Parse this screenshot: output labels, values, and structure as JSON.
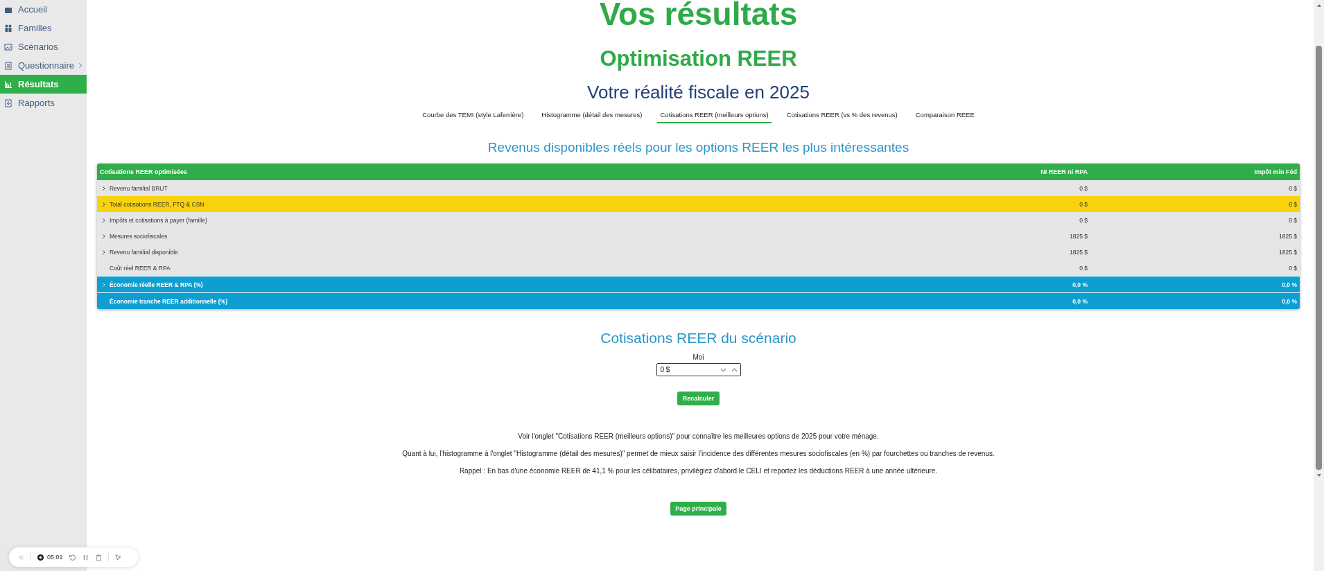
{
  "sidebar": {
    "items": [
      {
        "label": "Accueil",
        "selected": false,
        "submenu": false
      },
      {
        "label": "Familles",
        "selected": false,
        "submenu": false
      },
      {
        "label": "Scénarios",
        "selected": false,
        "submenu": false
      },
      {
        "label": "Questionnaire",
        "selected": false,
        "submenu": true
      },
      {
        "label": "Résultats",
        "selected": true,
        "submenu": false
      },
      {
        "label": "Rapports",
        "selected": false,
        "submenu": false
      }
    ]
  },
  "page_title": "Vos résultats",
  "section_title": "Optimisation REER",
  "subtitle": "Votre réalité fiscale en 2025",
  "tabs": [
    {
      "label": "Courbe des TEMI (style Laferrière)",
      "selected": false
    },
    {
      "label": "Histogramme (détail des mesures)",
      "selected": false
    },
    {
      "label": "Cotisations REER (meilleurs options)",
      "selected": true
    },
    {
      "label": "Cotisations REER (vs % des revenus)",
      "selected": false
    },
    {
      "label": "Comparaison REEE",
      "selected": false
    }
  ],
  "table_title": "Revenus disponibles réels pour les options REER les plus intéressantes",
  "table": {
    "columns": [
      "Cotisations REER optimisées",
      "NI REER ni RPA",
      "Impôt min Féd"
    ],
    "rows": [
      {
        "label": "Revenu familial BRUT",
        "kind": "normal",
        "expandable": true,
        "values": [
          "0 $",
          "0 $"
        ]
      },
      {
        "label": "Total cotisations REER, FTQ & CSN",
        "kind": "highlight",
        "expandable": true,
        "values": [
          "0 $",
          "0 $"
        ]
      },
      {
        "label": "Impôts et cotisations à payer (famille)",
        "kind": "normal",
        "expandable": true,
        "values": [
          "0 $",
          "0 $"
        ]
      },
      {
        "label": "Mesures sociofiscales",
        "kind": "normal",
        "expandable": true,
        "values": [
          "1825 $",
          "1825 $"
        ]
      },
      {
        "label": "Revenu familial disponible",
        "kind": "normal",
        "expandable": true,
        "values": [
          "1825 $",
          "1825 $"
        ]
      },
      {
        "label": "Coût réel REER & RPA",
        "kind": "normal",
        "expandable": false,
        "values": [
          "0 $",
          "0 $"
        ]
      },
      {
        "label": "Économie réelle REER & RPA (%)",
        "kind": "summary",
        "expandable": true,
        "values": [
          "0,0 %",
          "0,0 %"
        ]
      },
      {
        "label": "Économie tranche REER additionnelle (%)",
        "kind": "summary",
        "expandable": false,
        "values": [
          "0,0 %",
          "0,0 %"
        ]
      }
    ]
  },
  "scenario": {
    "title": "Cotisations REER du scénario",
    "field_label": "Moi",
    "value": "0 $",
    "button": "Recalculer"
  },
  "notes": [
    "Voir l'onglet \"Cotisations REER (meilleurs options)\" pour connaître les meilleures options de 2025 pour votre ménage.",
    "Quant à lui, l'histogramme à l'onglet \"Histogramme (détail des mesures)\" permet de mieux saisir l’incidence des différentes mesures sociofiscales (en %) par fourchettes ou tranches de revenus.",
    "Rappel : En bas d'une économie REER de 41,1 % pour les célibataires, privilégiez d'abord le CELI et reportez les déductions REER à une année ultérieure."
  ],
  "main_button": "Page principale",
  "recorder": {
    "time": "05:01"
  }
}
